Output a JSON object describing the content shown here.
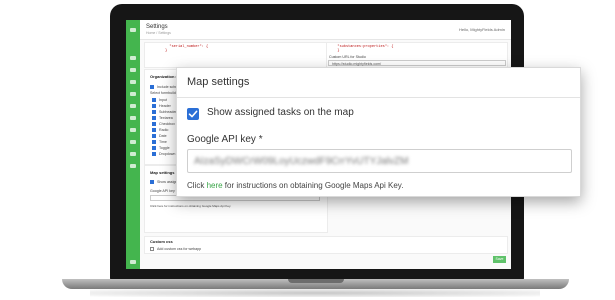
{
  "app": {
    "title": "Settings",
    "breadcrumb": "Home / Settings",
    "user": "Hello, MightyFields Admin"
  },
  "left_code": "  \"serial_number\": {\n}",
  "right_code": "  \"substances:properties\": {\n  }",
  "custom_url_label": "Custom URL for Studio",
  "custom_url_value": "https://studio.mightyfields.com/",
  "org_rights_heading": "Organization rights",
  "include_schema": "Include schema",
  "select_formbuilder": "Select formbuilder fields",
  "field_types": [
    "Input",
    "Header",
    "Subheader",
    "Textarea",
    "Checkbox",
    "Radio",
    "Date",
    "Time",
    "Toggle",
    "Dropdown"
  ],
  "map_section": {
    "heading": "Map settings",
    "show_tasks_label": "Show assigned tasks on the map",
    "api_key_label": "Google API key *",
    "api_key_value": "AIzaSyDWCrW09LoyUczwdF9CrrYvUTYJalvZM",
    "help_prefix": "Click ",
    "help_link": "here",
    "help_suffix": " for instructions on obtaining Google Maps Api Key."
  },
  "mini_map": {
    "heading": "Map settings",
    "show_tasks_label": "Show assigned tasks on the map",
    "api_key_label": "Google API key *",
    "help": "Click here for instructions on obtaining Google Maps Api Key."
  },
  "custom_css": {
    "heading": "Custom css",
    "option": "Add custom css for webapp"
  },
  "save_label": "Save"
}
